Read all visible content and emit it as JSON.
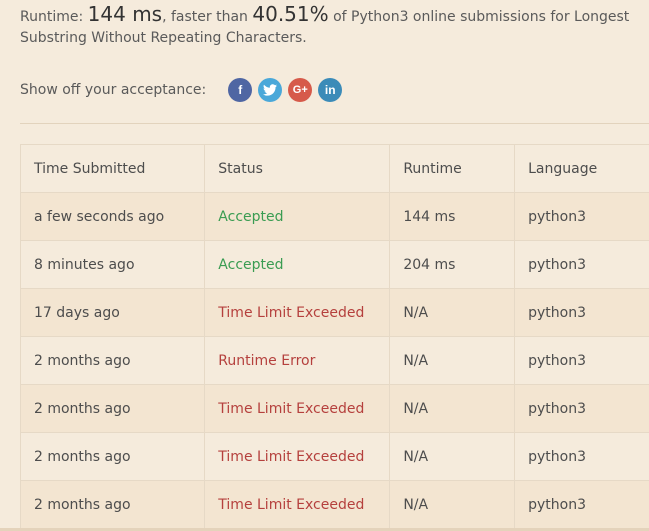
{
  "summary": {
    "runtime_label": "Runtime:",
    "runtime_value": "144 ms",
    "faster_text": ", faster than",
    "percent": "40.51%",
    "rest_text": "of Python3 online submissions for Longest Substring Without Repeating Characters."
  },
  "share": {
    "label": "Show off your acceptance:",
    "icons": [
      "facebook-icon",
      "twitter-icon",
      "google-plus-icon",
      "linkedin-icon"
    ]
  },
  "table": {
    "headers": [
      "Time Submitted",
      "Status",
      "Runtime",
      "Language"
    ],
    "rows": [
      {
        "time": "a few seconds ago",
        "status": "Accepted",
        "runtime": "144 ms",
        "language": "python3"
      },
      {
        "time": "8 minutes ago",
        "status": "Accepted",
        "runtime": "204 ms",
        "language": "python3"
      },
      {
        "time": "17 days ago",
        "status": "Time Limit Exceeded",
        "runtime": "N/A",
        "language": "python3"
      },
      {
        "time": "2 months ago",
        "status": "Runtime Error",
        "runtime": "N/A",
        "language": "python3"
      },
      {
        "time": "2 months ago",
        "status": "Time Limit Exceeded",
        "runtime": "N/A",
        "language": "python3"
      },
      {
        "time": "2 months ago",
        "status": "Time Limit Exceeded",
        "runtime": "N/A",
        "language": "python3"
      },
      {
        "time": "2 months ago",
        "status": "Time Limit Exceeded",
        "runtime": "N/A",
        "language": "python3"
      }
    ]
  },
  "colors": {
    "background": "#f5ebdc",
    "accepted": "#3a9c52",
    "error": "#b5403d"
  }
}
